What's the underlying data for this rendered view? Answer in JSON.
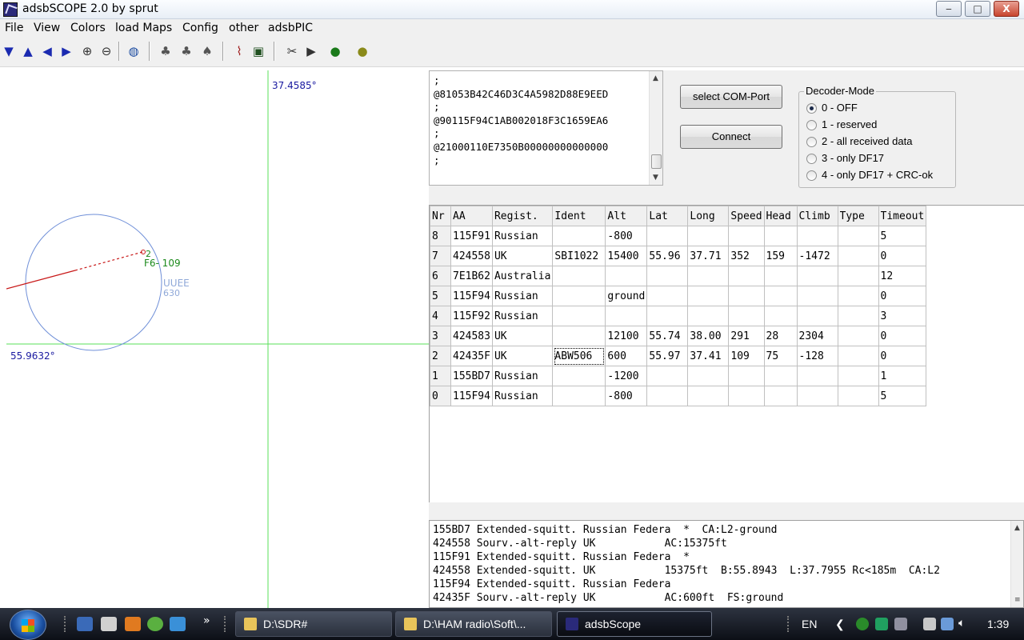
{
  "window": {
    "title": "adsbSCOPE 2.0 by sprut",
    "minimize": "‒",
    "maximize": "□",
    "close": "X"
  },
  "menu": [
    "File",
    "View",
    "Colors",
    "load Maps",
    "Config",
    "other",
    "adsbPIC"
  ],
  "map": {
    "lat_label": "55.9632°",
    "lon_label": "37.4585°",
    "airport": {
      "code": "UUEE",
      "elev": "630"
    },
    "aircraft": {
      "nr": "2",
      "label": "F6- 109"
    }
  },
  "raw_lines": [
    ";",
    "@81053B42C46D3C4A5982D88E9EED",
    ";",
    "@90115F94C1AB002018F3C1659EA6",
    ";",
    "@21000110E7350B00000000000000",
    ";"
  ],
  "buttons": {
    "select_com": "select COM-Port",
    "connect": "Connect"
  },
  "decoder": {
    "title": "Decoder-Mode",
    "options": [
      "0 - OFF",
      "1 - reserved",
      "2 - all received data",
      "3 - only DF17",
      "4 - only DF17 + CRC-ok"
    ],
    "selected": 0
  },
  "grid": {
    "headers": [
      "Nr",
      "AA",
      "Regist.",
      "Ident",
      "Alt",
      "Lat",
      "Long",
      "Speed",
      "Head",
      "Climb",
      "Type",
      "Timeout"
    ],
    "rows": [
      [
        "8",
        "115F91",
        "Russian",
        "",
        "-800",
        "",
        "",
        "",
        "",
        "",
        "",
        "5"
      ],
      [
        "7",
        "424558",
        "UK",
        "SBI1022",
        "15400",
        "55.96",
        "37.71",
        "352",
        "159",
        "-1472",
        "",
        "0"
      ],
      [
        "6",
        "7E1B62",
        "Australia",
        "",
        "",
        "",
        "",
        "",
        "",
        "",
        "",
        "12"
      ],
      [
        "5",
        "115F94",
        "Russian",
        "",
        "ground",
        "",
        "",
        "",
        "",
        "",
        "",
        "0"
      ],
      [
        "4",
        "115F92",
        "Russian",
        "",
        "",
        "",
        "",
        "",
        "",
        "",
        "",
        "3"
      ],
      [
        "3",
        "424583",
        "UK",
        "",
        "12100",
        "55.74",
        "38.00",
        "291",
        "28",
        "2304",
        "",
        "0"
      ],
      [
        "2",
        "42435F",
        "UK",
        "ABW506",
        "600",
        "55.97",
        "37.41",
        "109",
        "75",
        "-128",
        "",
        "0"
      ],
      [
        "1",
        "155BD7",
        "Russian",
        "",
        "-1200",
        "",
        "",
        "",
        "",
        "",
        "",
        "1"
      ],
      [
        "0",
        "115F94",
        "Russian",
        "",
        "-800",
        "",
        "",
        "",
        "",
        "",
        "",
        "5"
      ]
    ]
  },
  "log_lines": [
    "155BD7 Extended-squitt. Russian Federa  *  CA:L2-ground",
    "424558 Sourv.-alt-reply UK           AC:15375ft",
    "115F91 Extended-squitt. Russian Federa  *",
    "424558 Extended-squitt. UK           15375ft  B:55.8943  L:37.7955 Rc<185m  CA:L2",
    "115F94 Extended-squitt. Russian Federa",
    "42435F Sourv.-alt-reply UK           AC:600ft  FS:ground"
  ],
  "taskbar": {
    "tasks": [
      "D:\\SDR#",
      "D:\\HAM radio\\Soft\\...",
      "adsbScope"
    ],
    "lang": "EN",
    "clock": "1:39"
  },
  "colors": {
    "map_axis": "#58e058",
    "range_ring": "#6f8fd8",
    "track": "#c81818",
    "aircraft_label": "#1c8a1c",
    "airport": "#8fa8d8"
  }
}
